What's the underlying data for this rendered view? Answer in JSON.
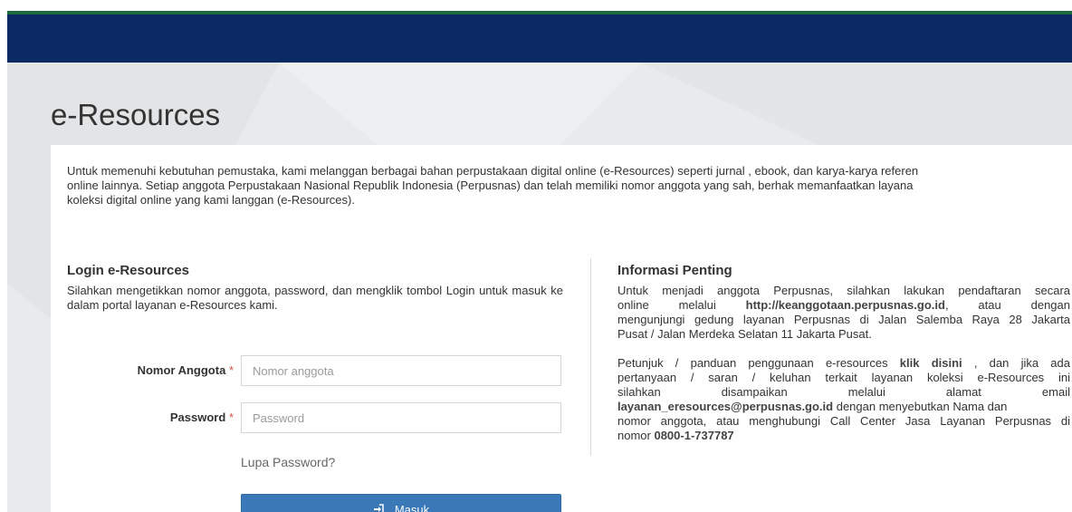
{
  "header": {
    "brand_color": "#0b2a63",
    "accent_color": "#1d6b3e"
  },
  "page": {
    "title": "e-Resources"
  },
  "intro": {
    "lines": [
      "Untuk memenuhi kebutuhan pemustaka, kami melanggan berbagai bahan perpustakaan digital online (e-Resources) seperti jurnal , ebook, dan karya-karya referen",
      "online lainnya. Setiap anggota Perpustakaan Nasional Republik Indonesia (Perpusnas) dan telah memiliki nomor anggota yang sah, berhak memanfaatkan layana",
      "koleksi digital online yang kami langgan (e-Resources)."
    ]
  },
  "login": {
    "title": "Login e-Resources",
    "description": "Silahkan mengetikkan nomor anggota, password, dan mengklik tombol Login untuk masuk ke dalam portal layanan e-Resources kami.",
    "member_label": "Nomor Anggota",
    "member_placeholder": "Nomor anggota",
    "password_label": "Password",
    "password_placeholder": "Password",
    "required_mark": "*",
    "forgot_label": "Lupa Password?",
    "submit_label": "Masuk",
    "submit_icon": "sign-in-icon",
    "submit_color": "#3a78b8"
  },
  "info": {
    "title": "Informasi Penting",
    "p1_lines": [
      [
        "Untuk menjadi anggota Perpusnas, silahkan lakukan pendaftaran secara",
        ""
      ],
      [
        "online melalui ",
        "http://keanggotaan.perpusnas.go.id",
        ", atau dengan"
      ],
      [
        "mengunjungi gedung layanan Perpusnas di Jalan Salemba Raya 28 Jakarta",
        ""
      ],
      [
        "Pusat / Jalan Merdeka Selatan 11 Jakarta Pusat.",
        ""
      ]
    ],
    "p2": {
      "a": "Petunjuk / panduan penggunaan e-resources",
      "link": "klik disini",
      "b": ", dan jika ada",
      "c": "pertanyaan / saran / keluhan terkait layanan koleksi e-Resources ini",
      "d": "silahkan disampaikan melalui alamat email",
      "email": "layanan_eresources@perpusnas.go.id",
      "e": " dengan menyebutkan Nama dan",
      "f": "nomor anggota, atau menghubungi Call Center Jasa Layanan Perpusnas di",
      "g": "nomor ",
      "phone": "0800-1-737787"
    }
  }
}
